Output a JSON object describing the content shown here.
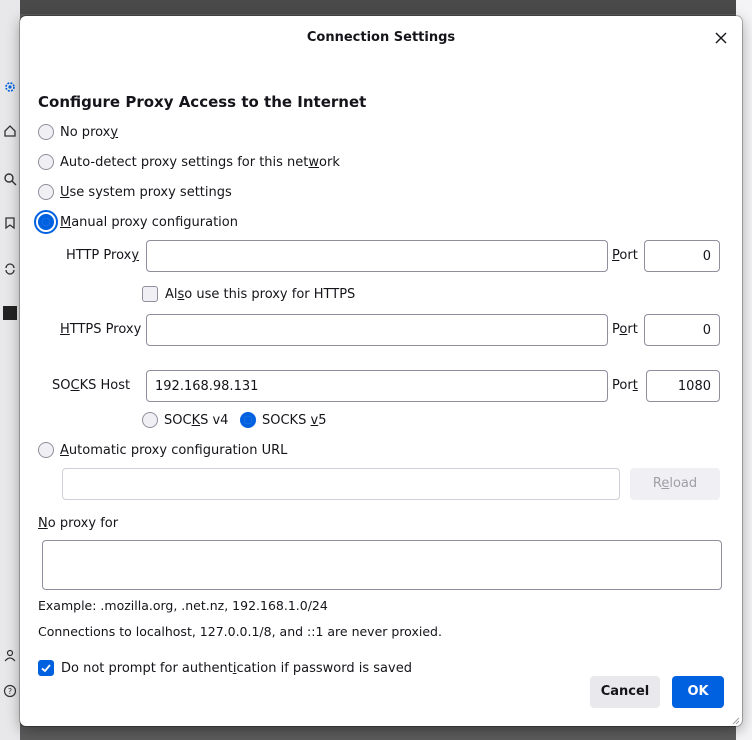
{
  "dialog": {
    "title": "Connection Settings",
    "heading": "Configure Proxy Access to the Internet"
  },
  "proxy_modes": [
    {
      "pre": "No prox",
      "key": "y",
      "post": "",
      "checked": false
    },
    {
      "pre": "Auto-detect proxy settings for this net",
      "key": "w",
      "post": "ork",
      "checked": false
    },
    {
      "pre": "",
      "key": "U",
      "post": "se system proxy settings",
      "checked": false
    },
    {
      "pre": "",
      "key": "M",
      "post": "anual proxy configuration",
      "checked": true
    }
  ],
  "manual": {
    "http_label_pre": "HTTP Prox",
    "http_label_key": "y",
    "http_value": "",
    "http_port_label_key": "P",
    "http_port_label_post": "ort",
    "http_port": "0",
    "also_https_pre": "Al",
    "also_https_key": "s",
    "also_https_post": "o use this proxy for HTTPS",
    "also_https_checked": false,
    "https_label_key": "H",
    "https_label_post": "TTPS Proxy",
    "https_value": "",
    "https_port_label_pre": "P",
    "https_port_label_key": "o",
    "https_port_label_post": "rt",
    "https_port": "0",
    "socks_label_pre": "SO",
    "socks_label_key": "C",
    "socks_label_post": "KS Host",
    "socks_value": "192.168.98.131",
    "socks_port_label_pre": "Por",
    "socks_port_label_key": "t",
    "socks_port": "1080",
    "socks_v4_pre": "SOC",
    "socks_v4_key": "K",
    "socks_v4_post": "S v4",
    "socks_v4_checked": false,
    "socks_v5_pre": "SOCKS ",
    "socks_v5_key": "v",
    "socks_v5_post": "5",
    "socks_v5_checked": true
  },
  "auto_url": {
    "label_key": "A",
    "label_post": "utomatic proxy configuration URL",
    "checked": false,
    "value": "",
    "reload_pre": "R",
    "reload_key": "e",
    "reload_post": "load"
  },
  "no_proxy": {
    "label_key": "N",
    "label_post": "o proxy for",
    "value": "",
    "example": "Example: .mozilla.org, .net.nz, 192.168.1.0/24",
    "note": "Connections to localhost, 127.0.0.1/8, and ::1 are never proxied."
  },
  "auth_prompt": {
    "pre": "Do not prompt for authent",
    "key": "i",
    "post": "cation if password is saved",
    "checked": true
  },
  "buttons": {
    "cancel": "Cancel",
    "ok": "OK"
  },
  "colors": {
    "accent": "#0061e0",
    "border": "#8f8f9d",
    "button_bg": "#e9e9ed"
  },
  "background_icons": [
    "settings-icon",
    "home-icon",
    "search-icon",
    "bookmark-icon",
    "sync-icon",
    "extension-icon",
    "profile-icon",
    "help-icon"
  ]
}
